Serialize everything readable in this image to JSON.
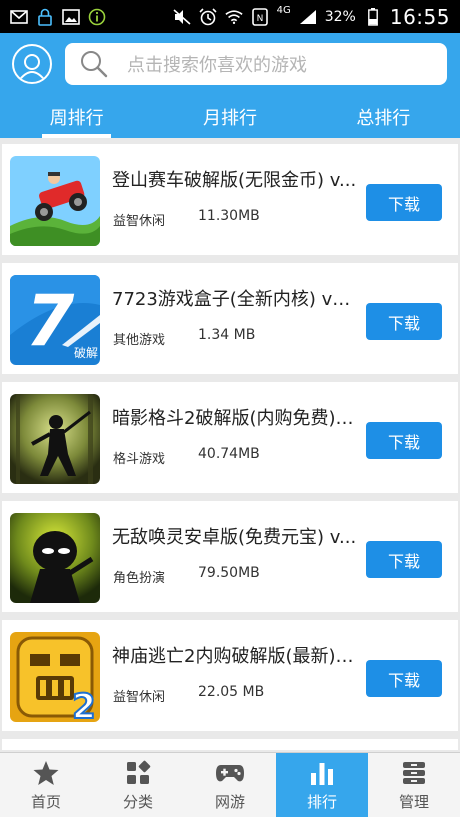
{
  "status_bar": {
    "network": "4G",
    "battery": "32%",
    "time": "16:55",
    "left_icons": [
      "email-icon",
      "lock-icon",
      "image-icon",
      "info-icon"
    ],
    "right_icons": [
      "mute-icon",
      "alarm-icon",
      "wifi-icon",
      "nfc-icon",
      "signal-icon",
      "battery-icon"
    ]
  },
  "header": {
    "search_placeholder": "点击搜索你喜欢的游戏",
    "tabs": [
      {
        "label": "周排行",
        "active": true
      },
      {
        "label": "月排行",
        "active": false
      },
      {
        "label": "总排行",
        "active": false
      }
    ]
  },
  "games": [
    {
      "title": "登山赛车破解版(无限金币) v...",
      "category": "益智休闲",
      "size": "11.30MB",
      "button": "下载",
      "icon": "hill-climb-icon"
    },
    {
      "title": "7723游戏盒子(全新内核) v1...",
      "category": "其他游戏",
      "size": "1.34 MB",
      "button": "下载",
      "icon": "7723-box-icon",
      "icon_text": "7",
      "icon_badge": "破解"
    },
    {
      "title": "暗影格斗2破解版(内购免费) ...",
      "category": "格斗游戏",
      "size": "40.74MB",
      "button": "下载",
      "icon": "shadow-fight-icon"
    },
    {
      "title": "无敌唤灵安卓版(免费元宝) v...",
      "category": "角色扮演",
      "size": "79.50MB",
      "button": "下载",
      "icon": "ninja-icon"
    },
    {
      "title": "神庙逃亡2内购破解版(最新) ...",
      "category": "益智休闲",
      "size": "22.05 MB",
      "button": "下载",
      "icon": "temple-run-icon",
      "icon_text": "2"
    }
  ],
  "bottom_nav": [
    {
      "label": "首页",
      "icon": "star-icon",
      "active": false
    },
    {
      "label": "分类",
      "icon": "category-icon",
      "active": false
    },
    {
      "label": "网游",
      "icon": "gamepad-icon",
      "active": false
    },
    {
      "label": "排行",
      "icon": "ranking-icon",
      "active": true
    },
    {
      "label": "管理",
      "icon": "manage-icon",
      "active": false
    }
  ],
  "colors": {
    "header_blue": "#36a6ec",
    "button_blue": "#1e8fe6",
    "background": "#e9e9e9"
  }
}
